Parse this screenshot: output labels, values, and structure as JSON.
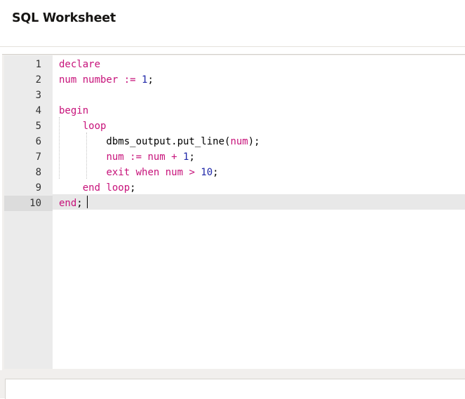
{
  "page": {
    "title": "SQL Worksheet"
  },
  "editor": {
    "active_line": 10,
    "lines": [
      {
        "num": "1",
        "tokens": [
          {
            "t": "declare",
            "c": "kw"
          }
        ]
      },
      {
        "num": "2",
        "tokens": [
          {
            "t": "num number ",
            "c": "kw"
          },
          {
            "t": ":=",
            "c": "kw"
          },
          {
            "t": " ",
            "c": "plain"
          },
          {
            "t": "1",
            "c": "num"
          },
          {
            "t": ";",
            "c": "plain"
          }
        ]
      },
      {
        "num": "3",
        "tokens": []
      },
      {
        "num": "4",
        "tokens": [
          {
            "t": "begin",
            "c": "kw"
          }
        ]
      },
      {
        "num": "5",
        "tokens": [
          {
            "t": "    ",
            "c": "plain"
          },
          {
            "t": "loop",
            "c": "kw"
          }
        ]
      },
      {
        "num": "6",
        "tokens": [
          {
            "t": "        dbms_output.put_line(",
            "c": "plain"
          },
          {
            "t": "num",
            "c": "kw"
          },
          {
            "t": ");",
            "c": "plain"
          }
        ]
      },
      {
        "num": "7",
        "tokens": [
          {
            "t": "        ",
            "c": "plain"
          },
          {
            "t": "num := num + ",
            "c": "kw"
          },
          {
            "t": "1",
            "c": "num"
          },
          {
            "t": ";",
            "c": "plain"
          }
        ]
      },
      {
        "num": "8",
        "tokens": [
          {
            "t": "        ",
            "c": "plain"
          },
          {
            "t": "exit when num > ",
            "c": "kw"
          },
          {
            "t": "10",
            "c": "num"
          },
          {
            "t": ";",
            "c": "plain"
          }
        ]
      },
      {
        "num": "9",
        "tokens": [
          {
            "t": "    ",
            "c": "plain"
          },
          {
            "t": "end loop",
            "c": "kw"
          },
          {
            "t": ";",
            "c": "plain"
          }
        ]
      },
      {
        "num": "10",
        "tokens": [
          {
            "t": "end",
            "c": "kw"
          },
          {
            "t": ";",
            "c": "plain"
          }
        ]
      }
    ]
  },
  "colors": {
    "keyword": "#c7127a",
    "number": "#1f27a8",
    "gutter_bg": "#ebebeb",
    "active_line_bg": "#e8e8e8"
  }
}
